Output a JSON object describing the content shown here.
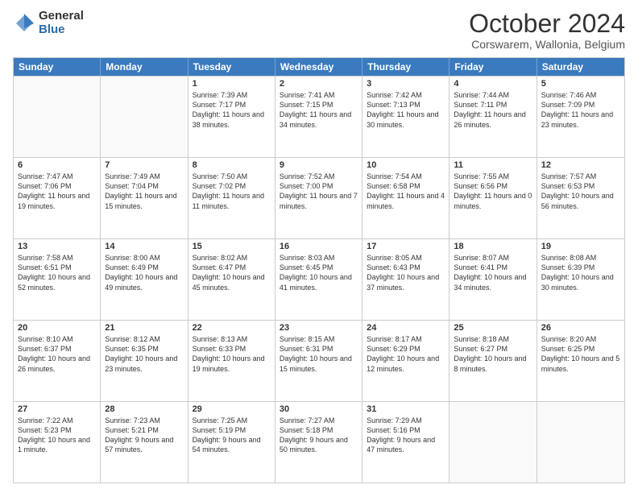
{
  "logo": {
    "general": "General",
    "blue": "Blue"
  },
  "header": {
    "title": "October 2024",
    "subtitle": "Corswarem, Wallonia, Belgium"
  },
  "calendar": {
    "days": [
      "Sunday",
      "Monday",
      "Tuesday",
      "Wednesday",
      "Thursday",
      "Friday",
      "Saturday"
    ],
    "rows": [
      [
        {
          "day": "",
          "empty": true
        },
        {
          "day": "",
          "empty": true
        },
        {
          "day": "1",
          "sunrise": "7:39 AM",
          "sunset": "7:17 PM",
          "daylight": "11 hours and 38 minutes."
        },
        {
          "day": "2",
          "sunrise": "7:41 AM",
          "sunset": "7:15 PM",
          "daylight": "11 hours and 34 minutes."
        },
        {
          "day": "3",
          "sunrise": "7:42 AM",
          "sunset": "7:13 PM",
          "daylight": "11 hours and 30 minutes."
        },
        {
          "day": "4",
          "sunrise": "7:44 AM",
          "sunset": "7:11 PM",
          "daylight": "11 hours and 26 minutes."
        },
        {
          "day": "5",
          "sunrise": "7:46 AM",
          "sunset": "7:09 PM",
          "daylight": "11 hours and 23 minutes."
        }
      ],
      [
        {
          "day": "6",
          "sunrise": "7:47 AM",
          "sunset": "7:06 PM",
          "daylight": "11 hours and 19 minutes."
        },
        {
          "day": "7",
          "sunrise": "7:49 AM",
          "sunset": "7:04 PM",
          "daylight": "11 hours and 15 minutes."
        },
        {
          "day": "8",
          "sunrise": "7:50 AM",
          "sunset": "7:02 PM",
          "daylight": "11 hours and 11 minutes."
        },
        {
          "day": "9",
          "sunrise": "7:52 AM",
          "sunset": "7:00 PM",
          "daylight": "11 hours and 7 minutes."
        },
        {
          "day": "10",
          "sunrise": "7:54 AM",
          "sunset": "6:58 PM",
          "daylight": "11 hours and 4 minutes."
        },
        {
          "day": "11",
          "sunrise": "7:55 AM",
          "sunset": "6:56 PM",
          "daylight": "11 hours and 0 minutes."
        },
        {
          "day": "12",
          "sunrise": "7:57 AM",
          "sunset": "6:53 PM",
          "daylight": "10 hours and 56 minutes."
        }
      ],
      [
        {
          "day": "13",
          "sunrise": "7:58 AM",
          "sunset": "6:51 PM",
          "daylight": "10 hours and 52 minutes."
        },
        {
          "day": "14",
          "sunrise": "8:00 AM",
          "sunset": "6:49 PM",
          "daylight": "10 hours and 49 minutes."
        },
        {
          "day": "15",
          "sunrise": "8:02 AM",
          "sunset": "6:47 PM",
          "daylight": "10 hours and 45 minutes."
        },
        {
          "day": "16",
          "sunrise": "8:03 AM",
          "sunset": "6:45 PM",
          "daylight": "10 hours and 41 minutes."
        },
        {
          "day": "17",
          "sunrise": "8:05 AM",
          "sunset": "6:43 PM",
          "daylight": "10 hours and 37 minutes."
        },
        {
          "day": "18",
          "sunrise": "8:07 AM",
          "sunset": "6:41 PM",
          "daylight": "10 hours and 34 minutes."
        },
        {
          "day": "19",
          "sunrise": "8:08 AM",
          "sunset": "6:39 PM",
          "daylight": "10 hours and 30 minutes."
        }
      ],
      [
        {
          "day": "20",
          "sunrise": "8:10 AM",
          "sunset": "6:37 PM",
          "daylight": "10 hours and 26 minutes."
        },
        {
          "day": "21",
          "sunrise": "8:12 AM",
          "sunset": "6:35 PM",
          "daylight": "10 hours and 23 minutes."
        },
        {
          "day": "22",
          "sunrise": "8:13 AM",
          "sunset": "6:33 PM",
          "daylight": "10 hours and 19 minutes."
        },
        {
          "day": "23",
          "sunrise": "8:15 AM",
          "sunset": "6:31 PM",
          "daylight": "10 hours and 15 minutes."
        },
        {
          "day": "24",
          "sunrise": "8:17 AM",
          "sunset": "6:29 PM",
          "daylight": "10 hours and 12 minutes."
        },
        {
          "day": "25",
          "sunrise": "8:18 AM",
          "sunset": "6:27 PM",
          "daylight": "10 hours and 8 minutes."
        },
        {
          "day": "26",
          "sunrise": "8:20 AM",
          "sunset": "6:25 PM",
          "daylight": "10 hours and 5 minutes."
        }
      ],
      [
        {
          "day": "27",
          "sunrise": "7:22 AM",
          "sunset": "5:23 PM",
          "daylight": "10 hours and 1 minute."
        },
        {
          "day": "28",
          "sunrise": "7:23 AM",
          "sunset": "5:21 PM",
          "daylight": "9 hours and 57 minutes."
        },
        {
          "day": "29",
          "sunrise": "7:25 AM",
          "sunset": "5:19 PM",
          "daylight": "9 hours and 54 minutes."
        },
        {
          "day": "30",
          "sunrise": "7:27 AM",
          "sunset": "5:18 PM",
          "daylight": "9 hours and 50 minutes."
        },
        {
          "day": "31",
          "sunrise": "7:29 AM",
          "sunset": "5:16 PM",
          "daylight": "9 hours and 47 minutes."
        },
        {
          "day": "",
          "empty": true
        },
        {
          "day": "",
          "empty": true
        }
      ]
    ]
  }
}
